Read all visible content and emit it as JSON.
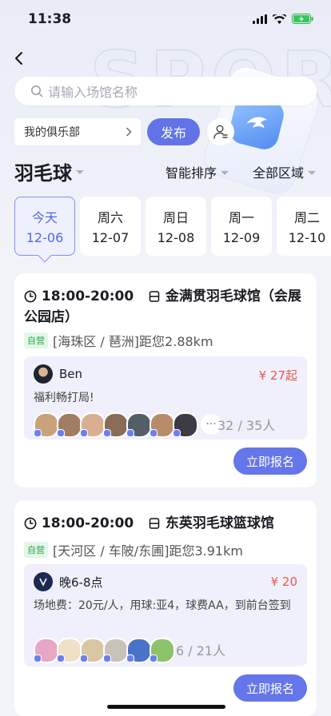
{
  "status_bar": {
    "time": "11:38"
  },
  "search": {
    "placeholder": "请输入场馆名称"
  },
  "toolbar": {
    "club_label": "我的俱乐部",
    "publish_label": "发布"
  },
  "filters": {
    "sport": "羽毛球",
    "sort": "智能排序",
    "region": "全部区域"
  },
  "dates": [
    {
      "weekday": "今天",
      "date": "12-06",
      "selected": true
    },
    {
      "weekday": "周六",
      "date": "12-07"
    },
    {
      "weekday": "周日",
      "date": "12-08"
    },
    {
      "weekday": "周一",
      "date": "12-09"
    },
    {
      "weekday": "周二",
      "date": "12-10"
    }
  ],
  "events": [
    {
      "time": "18:00-20:00",
      "venue": "金满贯羽毛球馆（会展公园店）",
      "tag": "自营",
      "location": "[海珠区 / 琶洲]距您2.88km",
      "poster": "Ben",
      "price": "¥ 27起",
      "description": "福利畅打局!",
      "more": "···",
      "count": "32 / 35人",
      "join_label": "立即报名",
      "avatar_colors": [
        "#c9a27c",
        "#a07d62",
        "#d8b091",
        "#8a6b55",
        "#555d66",
        "#b88c6a",
        "#3d3a44"
      ]
    },
    {
      "time": "18:00-20:00",
      "venue": "东英羽毛球篮球馆",
      "tag": "自营",
      "location": "[天河区 / 车陂/东圃]距您3.91km",
      "poster": "晚6-8点",
      "price": "¥ 20",
      "description": "场地费：20元/人，用球:亚4，球费AA，到前台签到",
      "count": "6 / 21人",
      "join_label": "立即报名",
      "avatar_colors": [
        "#e7a7c4",
        "#f0e0c8",
        "#d9c7a4",
        "#c8c2b8",
        "#4a72c9",
        "#8cc36a"
      ]
    }
  ],
  "colors": {
    "accent": "#6273e8",
    "price": "#e85a4f",
    "tag_green": "#2aa84f"
  },
  "icons": [
    "back-icon",
    "search-icon",
    "chevron-right-icon",
    "user-settings-icon",
    "clock-icon",
    "venue-icon",
    "signal-icon",
    "wifi-icon",
    "battery-icon"
  ]
}
